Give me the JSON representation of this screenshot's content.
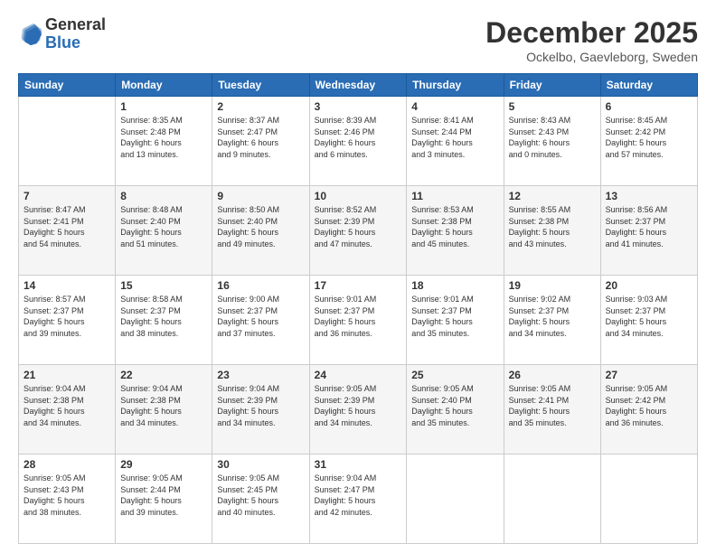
{
  "header": {
    "logo_general": "General",
    "logo_blue": "Blue",
    "month": "December 2025",
    "location": "Ockelbo, Gaevleborg, Sweden"
  },
  "days_of_week": [
    "Sunday",
    "Monday",
    "Tuesday",
    "Wednesday",
    "Thursday",
    "Friday",
    "Saturday"
  ],
  "weeks": [
    [
      {
        "num": "",
        "info": ""
      },
      {
        "num": "1",
        "info": "Sunrise: 8:35 AM\nSunset: 2:48 PM\nDaylight: 6 hours\nand 13 minutes."
      },
      {
        "num": "2",
        "info": "Sunrise: 8:37 AM\nSunset: 2:47 PM\nDaylight: 6 hours\nand 9 minutes."
      },
      {
        "num": "3",
        "info": "Sunrise: 8:39 AM\nSunset: 2:46 PM\nDaylight: 6 hours\nand 6 minutes."
      },
      {
        "num": "4",
        "info": "Sunrise: 8:41 AM\nSunset: 2:44 PM\nDaylight: 6 hours\nand 3 minutes."
      },
      {
        "num": "5",
        "info": "Sunrise: 8:43 AM\nSunset: 2:43 PM\nDaylight: 6 hours\nand 0 minutes."
      },
      {
        "num": "6",
        "info": "Sunrise: 8:45 AM\nSunset: 2:42 PM\nDaylight: 5 hours\nand 57 minutes."
      }
    ],
    [
      {
        "num": "7",
        "info": "Sunrise: 8:47 AM\nSunset: 2:41 PM\nDaylight: 5 hours\nand 54 minutes."
      },
      {
        "num": "8",
        "info": "Sunrise: 8:48 AM\nSunset: 2:40 PM\nDaylight: 5 hours\nand 51 minutes."
      },
      {
        "num": "9",
        "info": "Sunrise: 8:50 AM\nSunset: 2:40 PM\nDaylight: 5 hours\nand 49 minutes."
      },
      {
        "num": "10",
        "info": "Sunrise: 8:52 AM\nSunset: 2:39 PM\nDaylight: 5 hours\nand 47 minutes."
      },
      {
        "num": "11",
        "info": "Sunrise: 8:53 AM\nSunset: 2:38 PM\nDaylight: 5 hours\nand 45 minutes."
      },
      {
        "num": "12",
        "info": "Sunrise: 8:55 AM\nSunset: 2:38 PM\nDaylight: 5 hours\nand 43 minutes."
      },
      {
        "num": "13",
        "info": "Sunrise: 8:56 AM\nSunset: 2:37 PM\nDaylight: 5 hours\nand 41 minutes."
      }
    ],
    [
      {
        "num": "14",
        "info": "Sunrise: 8:57 AM\nSunset: 2:37 PM\nDaylight: 5 hours\nand 39 minutes."
      },
      {
        "num": "15",
        "info": "Sunrise: 8:58 AM\nSunset: 2:37 PM\nDaylight: 5 hours\nand 38 minutes."
      },
      {
        "num": "16",
        "info": "Sunrise: 9:00 AM\nSunset: 2:37 PM\nDaylight: 5 hours\nand 37 minutes."
      },
      {
        "num": "17",
        "info": "Sunrise: 9:01 AM\nSunset: 2:37 PM\nDaylight: 5 hours\nand 36 minutes."
      },
      {
        "num": "18",
        "info": "Sunrise: 9:01 AM\nSunset: 2:37 PM\nDaylight: 5 hours\nand 35 minutes."
      },
      {
        "num": "19",
        "info": "Sunrise: 9:02 AM\nSunset: 2:37 PM\nDaylight: 5 hours\nand 34 minutes."
      },
      {
        "num": "20",
        "info": "Sunrise: 9:03 AM\nSunset: 2:37 PM\nDaylight: 5 hours\nand 34 minutes."
      }
    ],
    [
      {
        "num": "21",
        "info": "Sunrise: 9:04 AM\nSunset: 2:38 PM\nDaylight: 5 hours\nand 34 minutes."
      },
      {
        "num": "22",
        "info": "Sunrise: 9:04 AM\nSunset: 2:38 PM\nDaylight: 5 hours\nand 34 minutes."
      },
      {
        "num": "23",
        "info": "Sunrise: 9:04 AM\nSunset: 2:39 PM\nDaylight: 5 hours\nand 34 minutes."
      },
      {
        "num": "24",
        "info": "Sunrise: 9:05 AM\nSunset: 2:39 PM\nDaylight: 5 hours\nand 34 minutes."
      },
      {
        "num": "25",
        "info": "Sunrise: 9:05 AM\nSunset: 2:40 PM\nDaylight: 5 hours\nand 35 minutes."
      },
      {
        "num": "26",
        "info": "Sunrise: 9:05 AM\nSunset: 2:41 PM\nDaylight: 5 hours\nand 35 minutes."
      },
      {
        "num": "27",
        "info": "Sunrise: 9:05 AM\nSunset: 2:42 PM\nDaylight: 5 hours\nand 36 minutes."
      }
    ],
    [
      {
        "num": "28",
        "info": "Sunrise: 9:05 AM\nSunset: 2:43 PM\nDaylight: 5 hours\nand 38 minutes."
      },
      {
        "num": "29",
        "info": "Sunrise: 9:05 AM\nSunset: 2:44 PM\nDaylight: 5 hours\nand 39 minutes."
      },
      {
        "num": "30",
        "info": "Sunrise: 9:05 AM\nSunset: 2:45 PM\nDaylight: 5 hours\nand 40 minutes."
      },
      {
        "num": "31",
        "info": "Sunrise: 9:04 AM\nSunset: 2:47 PM\nDaylight: 5 hours\nand 42 minutes."
      },
      {
        "num": "",
        "info": ""
      },
      {
        "num": "",
        "info": ""
      },
      {
        "num": "",
        "info": ""
      }
    ]
  ]
}
